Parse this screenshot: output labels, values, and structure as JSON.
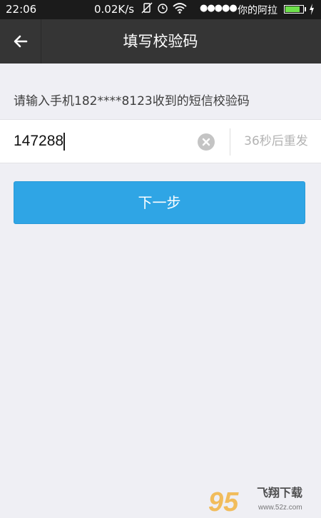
{
  "status_bar": {
    "time": "22:06",
    "network_speed": "0.02K/s",
    "signal": "●●●●●",
    "carrier": "你的阿拉",
    "battery_level": 0.85
  },
  "header": {
    "title": "填写校验码"
  },
  "hint": "请输入手机182****8123收到的短信校验码",
  "code_field": {
    "value": "147288"
  },
  "resend": {
    "label": "36秒后重发"
  },
  "next_button": {
    "label": "下一步"
  },
  "watermark": {
    "brand": "飞翔下载",
    "number": "95",
    "site": "www.52z.com"
  },
  "colors": {
    "accent": "#2fa5e5",
    "header_bg": "#353535",
    "page_bg": "#efeff4"
  }
}
